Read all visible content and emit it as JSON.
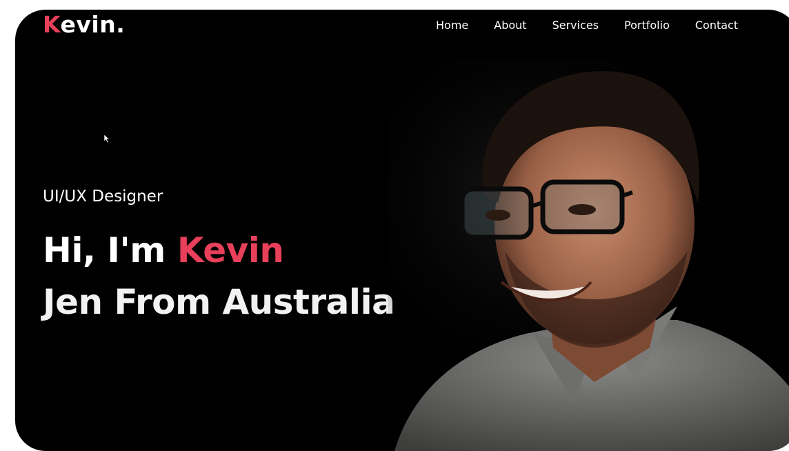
{
  "logo": {
    "first_letter": "K",
    "rest": "evin."
  },
  "nav": {
    "items": [
      {
        "label": "Home"
      },
      {
        "label": "About"
      },
      {
        "label": "Services"
      },
      {
        "label": "Portfolio"
      },
      {
        "label": "Contact"
      }
    ]
  },
  "hero": {
    "subtitle": "UI/UX Designer",
    "greeting": "Hi, I'm",
    "name": "Kevin",
    "line2": "Jen From Australia"
  },
  "colors": {
    "background": "#000000",
    "accent": "#e8405a",
    "text": "#ffffff"
  },
  "icons": {
    "cursor": "mouse-pointer-icon"
  }
}
